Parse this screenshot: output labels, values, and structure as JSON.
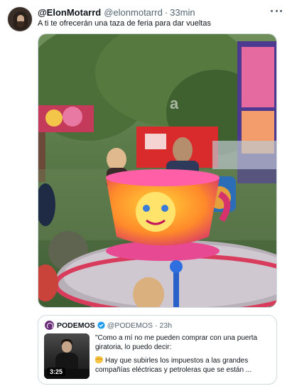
{
  "tweet": {
    "author_name": "@ElonMotarrd",
    "author_handle": "@elonmotarrd",
    "separator": "·",
    "time": "33min",
    "text": "A ti te ofrecerán una taza de feria para dar vueltas",
    "avatar_icon": "user-avatar",
    "more_icon": "more-dots-icon",
    "image_watermark": "a"
  },
  "quoted": {
    "author_name": "PODEMOS",
    "author_handle": "@PODEMOS",
    "separator": "·",
    "time": "23h",
    "verified_color": "#1d9bf0",
    "video_duration": "3:25",
    "line1": "\"Como a mí no me pueden comprar con una puerta giratoria, lo puedo decir:",
    "line2": "Hay que subirles los impuestos a las grandes compañías eléctricas y petroleras que se están ..."
  }
}
